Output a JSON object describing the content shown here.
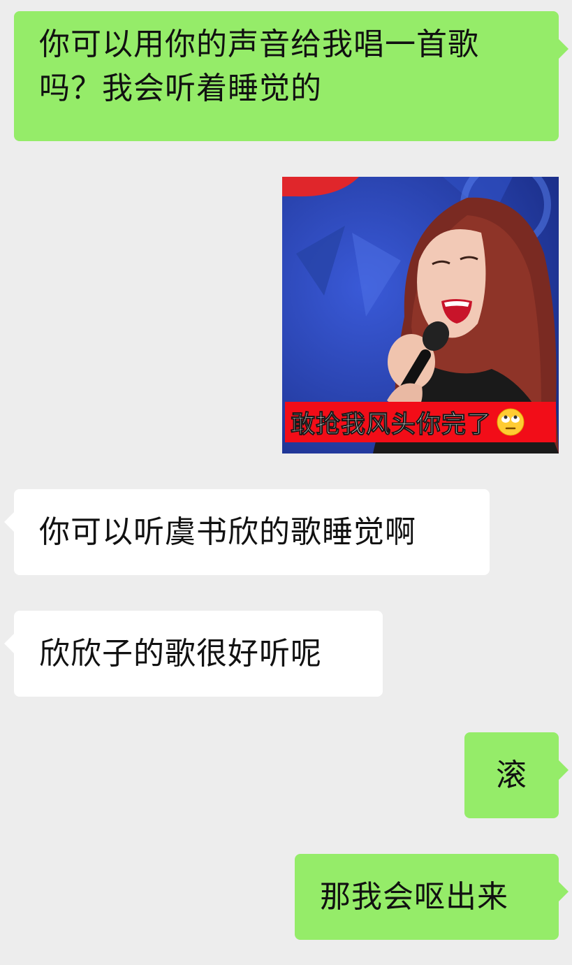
{
  "messages": [
    {
      "side": "out",
      "text": "你可以用你的声音给我唱一首歌吗？我会听着睡觉的"
    },
    {
      "side": "in",
      "type": "sticker",
      "caption": "敢抢我风头你完了",
      "emoji_icon": "eye-roll-emoji-icon"
    },
    {
      "side": "in",
      "text": "你可以听虞书欣的歌睡觉啊"
    },
    {
      "side": "in",
      "text": "欣欣子的歌很好听呢"
    },
    {
      "side": "out",
      "text": "滚"
    },
    {
      "side": "out",
      "text": "那我会呕出来"
    }
  ],
  "colors": {
    "background": "#ededed",
    "outgoing_bubble": "#95ec69",
    "incoming_bubble": "#ffffff",
    "caption_bar": "#f20d18"
  }
}
